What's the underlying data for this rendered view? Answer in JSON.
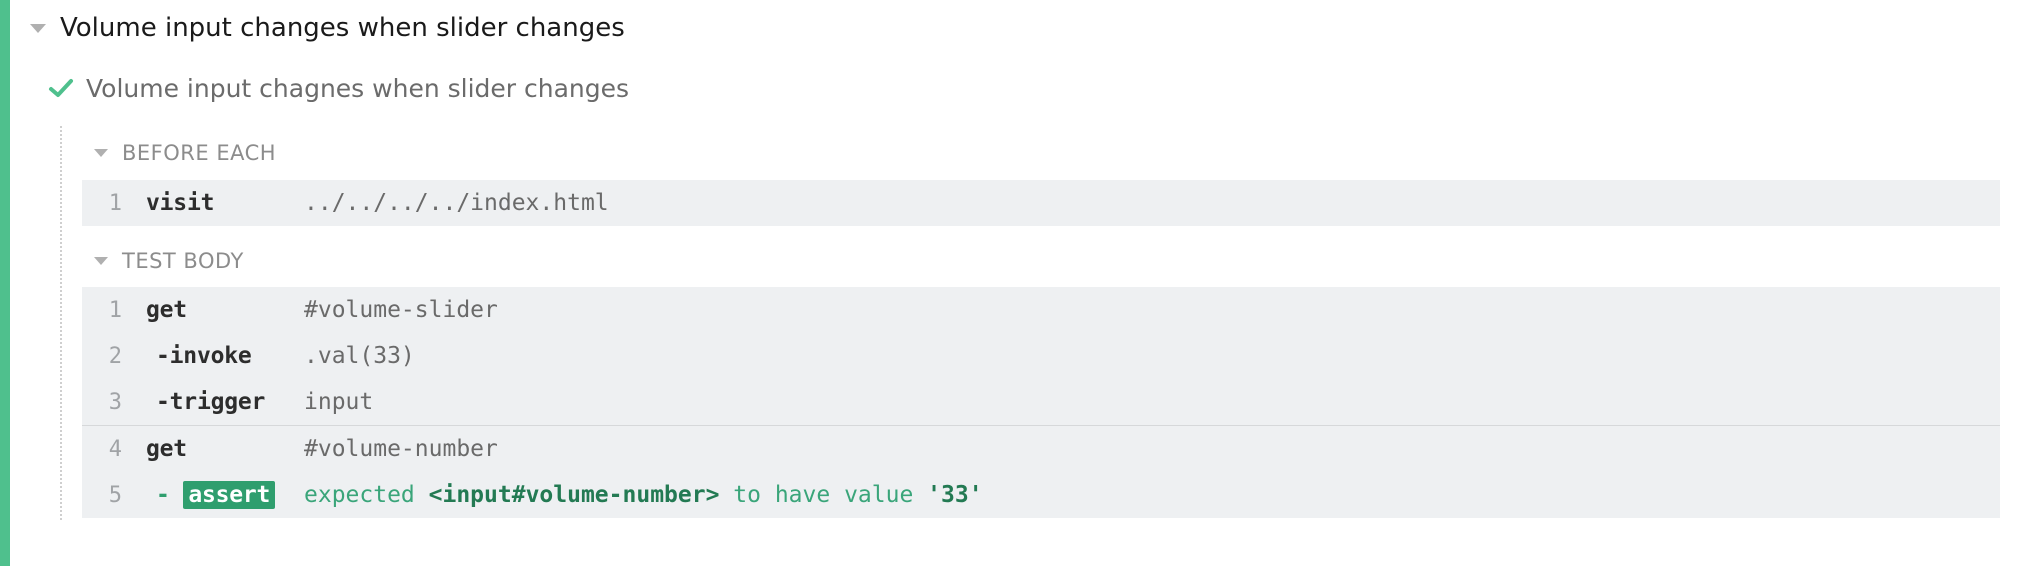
{
  "suite": {
    "title": "Volume input changes when slider changes"
  },
  "test": {
    "title": "Volume input chagnes when slider changes",
    "status": "passed"
  },
  "colors": {
    "pass": "#4fc08d",
    "assert_badge": "#2f9e6e"
  },
  "before_each": {
    "label": "BEFORE EACH",
    "commands": [
      {
        "num": "1",
        "name": "visit",
        "message": "../../../../index.html"
      }
    ]
  },
  "test_body": {
    "label": "TEST BODY",
    "commands": [
      {
        "num": "1",
        "name": "get",
        "message": "#volume-slider"
      },
      {
        "num": "2",
        "name": "-invoke",
        "message": ".val(33)"
      },
      {
        "num": "3",
        "name": "-trigger",
        "message": "input"
      },
      {
        "num": "4",
        "name": "get",
        "message": "#volume-number"
      },
      {
        "num": "5",
        "dash": "-",
        "name": "assert",
        "message_parts": {
          "a": "expected",
          "b": "<input#volume-number>",
          "c": "to have value",
          "d": "'33'"
        }
      }
    ]
  }
}
